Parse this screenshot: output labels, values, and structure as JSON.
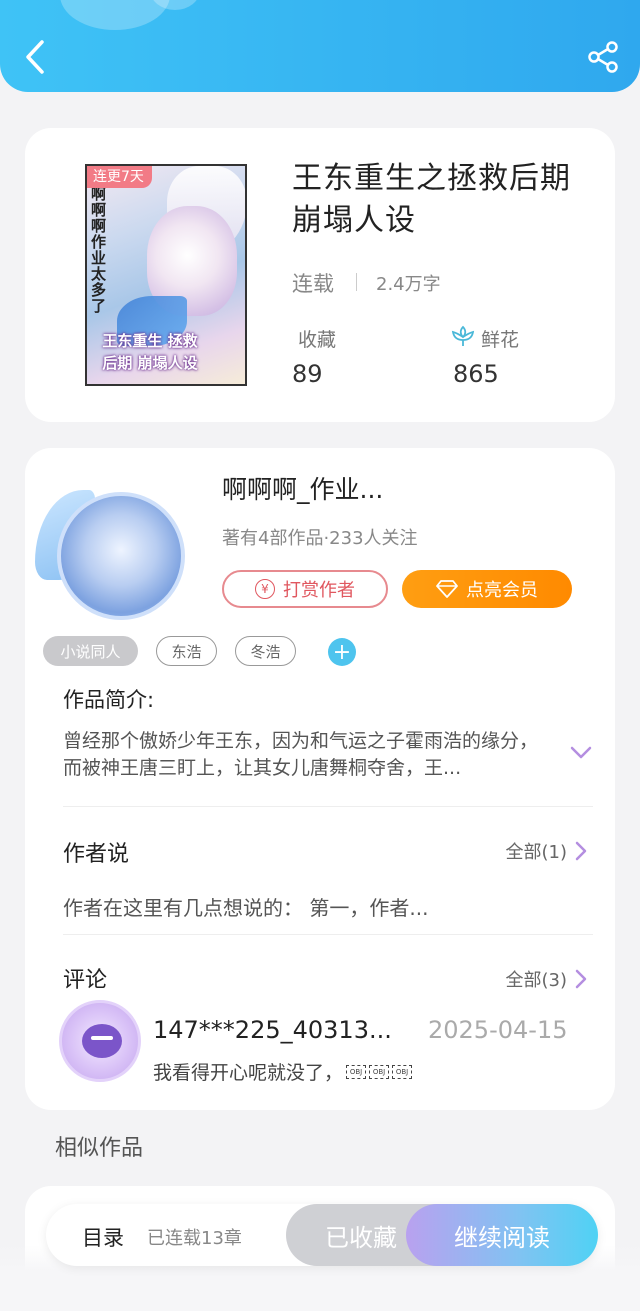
{
  "header": {
    "back_icon": "chevron-left-icon",
    "share_icon": "share-icon",
    "color": "#33b4f2"
  },
  "book": {
    "badge": "连更7天",
    "cover_vertical_text": "啊啊啊作业太多了",
    "cover_title": "王东重生 拯救后期 崩塌人设",
    "title": "王东重生之拯救后期崩塌人设",
    "status": "连载",
    "word_count": "2.4万字",
    "favorites_label": "收藏",
    "favorites_value": "89",
    "flowers_label": "鲜花",
    "flowers_value": "865"
  },
  "author": {
    "name": "啊啊啊_作业...",
    "meta": "著有4部作品·233人关注",
    "reward_label": "打赏作者",
    "vip_label": "点亮会员"
  },
  "tags": [
    "小说同人",
    "东浩",
    "冬浩"
  ],
  "intro": {
    "title": "作品简介:",
    "text": "曾经那个傲娇少年王东，因为和气运之子霍雨浩的缘分，而被神王唐三盯上，让其女儿唐舞桐夺舍，王..."
  },
  "author_say": {
    "title": "作者说",
    "more": "全部(1)",
    "text": "作者在这里有几点想说的：  第一，作者..."
  },
  "comments": {
    "title": "评论",
    "more": "全部(3)",
    "user": "147***225_40313...",
    "date": "2025-04-15",
    "text": "我看得开心呢就没了，",
    "obj_label": "OBJ"
  },
  "similar": {
    "title": "相似作品"
  },
  "bottom_bar": {
    "toc": "目录",
    "chapters": "已连载13章",
    "collected": "已收藏",
    "continue": "继续阅读"
  }
}
